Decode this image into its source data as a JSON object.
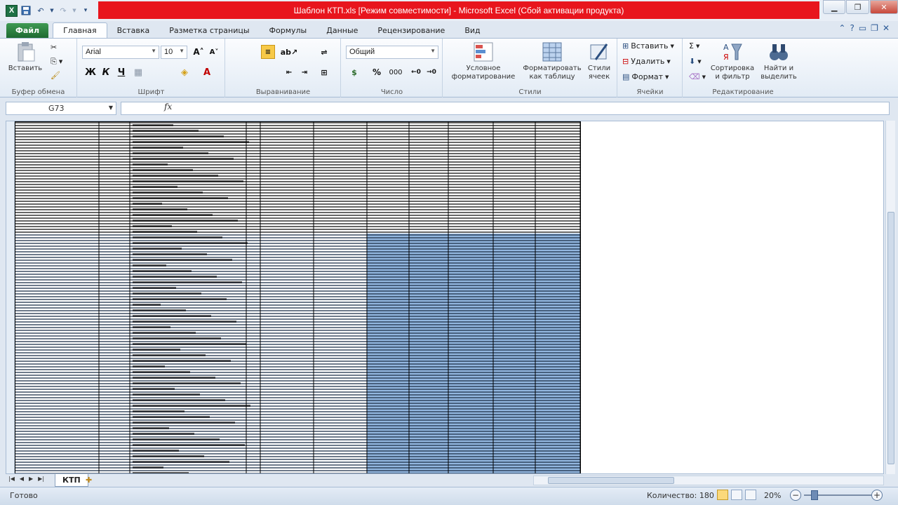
{
  "window": {
    "title": "Шаблон КТП.xls [Режим совместимости] - Microsoft Excel (Сбой активации продукта)",
    "app_icon": "excel-icon"
  },
  "quick_access": [
    "save-icon",
    "undo-icon",
    "redo-icon",
    "customize-icon"
  ],
  "tabs": {
    "file": "Файл",
    "items": [
      "Главная",
      "Вставка",
      "Разметка страницы",
      "Формулы",
      "Данные",
      "Рецензирование",
      "Вид"
    ]
  },
  "ribbon": {
    "clipboard": {
      "paste": "Вставить",
      "group": "Буфер обмена"
    },
    "font": {
      "name": "Arial",
      "size": "10",
      "bold": "Ж",
      "italic": "К",
      "underline": "Ч",
      "group": "Шрифт"
    },
    "alignment": {
      "group": "Выравнивание"
    },
    "number": {
      "format": "Общий",
      "percent": "%",
      "thousands": "000",
      "group": "Число"
    },
    "styles": {
      "conditional_1": "Условное",
      "conditional_2": "форматирование",
      "as_table_1": "Форматировать",
      "as_table_2": "как таблицу",
      "cell_styles_1": "Стили",
      "cell_styles_2": "ячеек",
      "group": "Стили"
    },
    "cells": {
      "insert": "Вставить",
      "delete": "Удалить",
      "format": "Формат",
      "group": "Ячейки"
    },
    "editing": {
      "sort_1": "Сортировка",
      "sort_2": "и фильтр",
      "find_1": "Найти и",
      "find_2": "выделить",
      "group": "Редактирование"
    }
  },
  "formula_bar": {
    "name_box": "G73",
    "fx": "fx",
    "formula": ""
  },
  "sheet": {
    "tab_name": "КТП"
  },
  "status": {
    "ready": "Готово",
    "count": "Количество: 180",
    "zoom": "20%"
  },
  "colors": {
    "title_red": "#e8151d",
    "file_green": "#1e6a31",
    "selection": "#6f9fd6"
  }
}
